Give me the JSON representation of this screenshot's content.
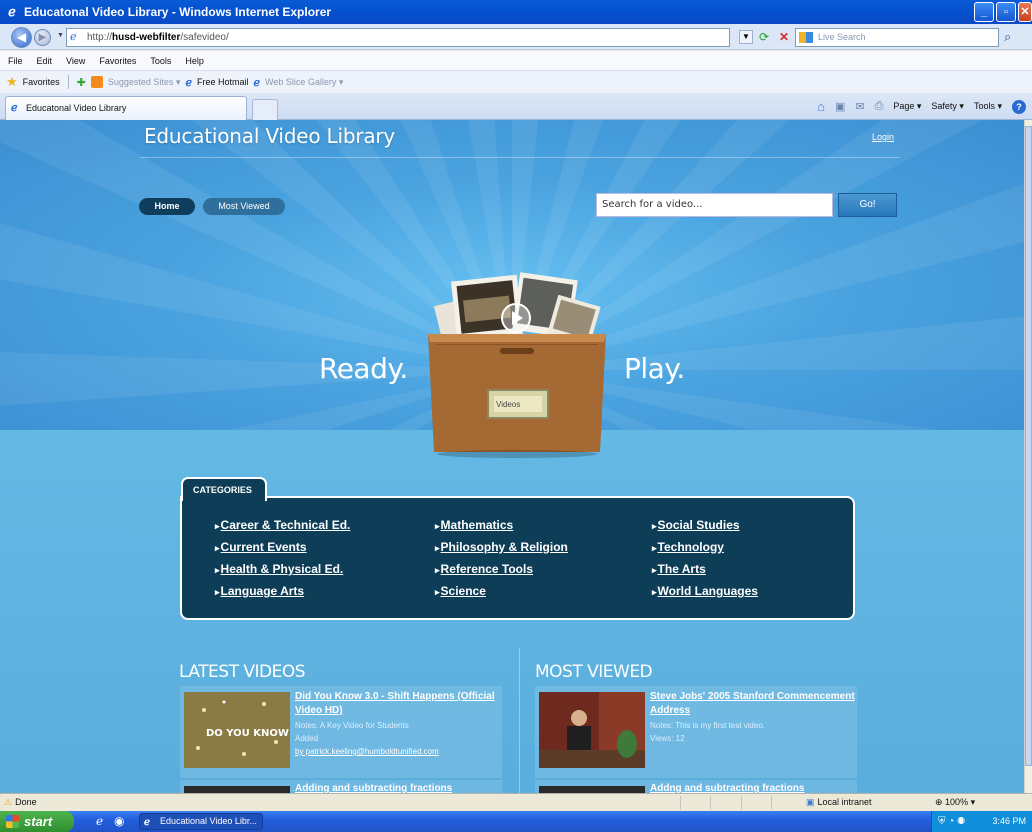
{
  "window": {
    "title": "Educatonal Video Library - Windows Internet Explorer"
  },
  "address": {
    "url_prefix": "http://",
    "url_host": "husd-webfilter",
    "url_path": "/safevideo/",
    "search_placeholder": "Live Search"
  },
  "menu": [
    "File",
    "Edit",
    "View",
    "Favorites",
    "Tools",
    "Help"
  ],
  "favorites_bar": {
    "favorites": "Favorites",
    "suggested": "Suggested Sites ▾",
    "hotmail": "Free Hotmail",
    "slice": "Web Slice Gallery ▾"
  },
  "tab": {
    "label": "Educatonal Video Library"
  },
  "commands": {
    "page": "Page ▾",
    "safety": "Safety ▾",
    "tools": "Tools ▾"
  },
  "page": {
    "site_title": "Educational Video Library",
    "login": "Login",
    "nav_home": "Home",
    "nav_most_viewed": "Most Viewed",
    "search_value": "Search for a video...",
    "go_label": "Go!",
    "ready": "Ready.",
    "play": "Play.",
    "box_label": "Videos",
    "categories_label": "CATEGORIES",
    "categories": [
      "Career & Technical Ed.",
      "Current Events",
      "Health & Physical Ed.",
      "Language Arts",
      "Mathematics",
      "Philosophy & Religion",
      "Reference Tools",
      "Science",
      "Social Studies",
      "Technology",
      "The Arts",
      "World Languages"
    ],
    "latest_heading": "LATEST VIDEOS",
    "most_heading": "MOST VIEWED",
    "latest": [
      {
        "title": "Did You Know 3.0 - Shift Happens (Official Video HD)",
        "notes": "Notes: A Key Video for Students",
        "added": "Added",
        "by": "by patrick.keeling@humboldtunified.com",
        "thumb_text": "DO YOU KNOW ?"
      },
      {
        "title": "Adding and subtracting fractions"
      }
    ],
    "most": [
      {
        "title": "Steve Jobs' 2005 Stanford Commencement Address",
        "notes": "Notes: This is my first test video.",
        "views": "Views: 12"
      },
      {
        "title": "Addng and subtracting fractions"
      }
    ]
  },
  "status": {
    "done": "Done",
    "zone": "Local intranet",
    "zoom": "100%"
  },
  "taskbar": {
    "start": "start",
    "task": "Educational Video Libr...",
    "clock": "3:46 PM"
  }
}
